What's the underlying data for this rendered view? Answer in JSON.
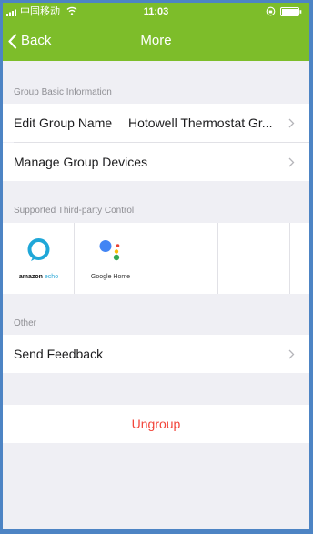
{
  "status_bar": {
    "carrier": "中国移动",
    "time": "11:03"
  },
  "nav": {
    "back_label": "Back",
    "title": "More"
  },
  "sections": {
    "group_info": {
      "header": "Group Basic Information",
      "edit_name_label": "Edit Group Name",
      "edit_name_value": "Hotowell Thermostat Gr...",
      "manage_devices_label": "Manage Group Devices"
    },
    "third_party": {
      "header": "Supported Third-party Control",
      "services": [
        {
          "name_part1": "amazon",
          "name_part2": "echo",
          "icon": "alexa-ring-icon"
        },
        {
          "name": "Google Home",
          "icon": "google-assistant-icon"
        }
      ]
    },
    "other": {
      "header": "Other",
      "feedback_label": "Send Feedback"
    }
  },
  "ungroup_label": "Ungroup",
  "colors": {
    "header": "#7dbd2a",
    "background": "#efeff4",
    "danger": "#f2453a",
    "alexa": "#1fa7d8",
    "google_blue": "#4285f4",
    "google_red": "#ea4335",
    "google_yellow": "#fbbc05",
    "google_green": "#34a853"
  }
}
